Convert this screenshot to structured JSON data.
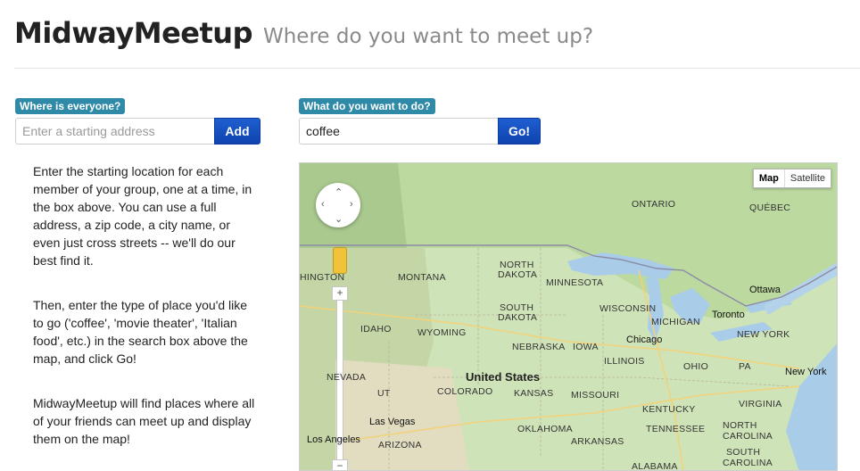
{
  "header": {
    "brand": "MidwayMeetup",
    "tagline": "Where do you want to meet up?"
  },
  "location": {
    "badge": "Where is everyone?",
    "placeholder": "Enter a starting address",
    "add_label": "Add"
  },
  "search": {
    "badge": "What do you want to do?",
    "value": "coffee",
    "go_label": "Go!"
  },
  "help": [
    "Enter the starting location for each member of your group, one at a time, in the box above. You can use a full address, a zip code, a city name, or even just cross streets -- we'll do our best find it.",
    "Then, enter the type of place you'd like to go ('coffee', 'movie theater', 'Italian food', etc.) in the search box above the map, and click Go!",
    "MidwayMeetup will find places where all of your friends can meet up and display them on the map!"
  ],
  "map": {
    "type_map": "Map",
    "type_satellite": "Satellite",
    "zoom_in": "+",
    "zoom_out": "−",
    "country": "United States",
    "regions": {
      "ontario": "ONTARIO",
      "quebec": "QUÉBEC",
      "north_dakota_1": "NORTH",
      "north_dakota_2": "DAKOTA",
      "south_dakota_1": "SOUTH",
      "south_dakota_2": "DAKOTA",
      "montana": "MONTANA",
      "minnesota": "MINNESOTA",
      "wisconsin": "WISCONSIN",
      "michigan": "MICHIGAN",
      "idaho": "IDAHO",
      "wyoming": "WYOMING",
      "nebraska": "NEBRASKA",
      "iowa": "IOWA",
      "illinois": "ILLINOIS",
      "ohio": "OHIO",
      "new_york": "NEW YORK",
      "pa": "PA",
      "nevada": "NEVADA",
      "colorado": "COLORADO",
      "kansas": "KANSAS",
      "missouri": "MISSOURI",
      "kentucky": "KENTUCKY",
      "tennessee": "TENNESSEE",
      "oklahoma": "OKLAHOMA",
      "arkansas": "ARKANSAS",
      "arizona": "ARIZONA",
      "alabama": "ALABAMA",
      "north_carolina_1": "NORTH",
      "north_carolina_2": "CAROLINA",
      "south_carolina_1": "SOUTH",
      "south_carolina_2": "CAROLINA",
      "virginia": "VIRGINIA",
      "washington": "HINGTON",
      "ut": "UT"
    },
    "cities": {
      "ottawa": "Ottawa",
      "toronto": "Toronto",
      "chicago": "Chicago",
      "new_york": "New York",
      "las_vegas": "Las Vegas",
      "los_angeles": "Los Angeles"
    }
  }
}
